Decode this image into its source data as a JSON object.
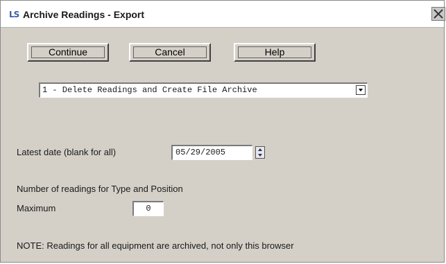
{
  "window": {
    "title": "Archive Readings - Export",
    "icon": "archive-app-icon"
  },
  "buttons": {
    "continue_label": "Continue",
    "cancel_label": "Cancel",
    "help_label": "Help"
  },
  "archive_mode": {
    "selected": "1 - Delete Readings and Create File Archive"
  },
  "latest_date": {
    "label": "Latest date (blank for all)",
    "value": "05/29/2005"
  },
  "readings": {
    "heading": "Number of readings for Type and Position",
    "maximum_label": "Maximum",
    "maximum_value": "0"
  },
  "note": "NOTE: Readings for all equipment are archived, not only this browser",
  "colors": {
    "dialog_background": "#d4d0c8",
    "titlebar_background": "#ffffff",
    "app_icon": "#3a5fa8",
    "close_button": "#c8c8c8"
  }
}
